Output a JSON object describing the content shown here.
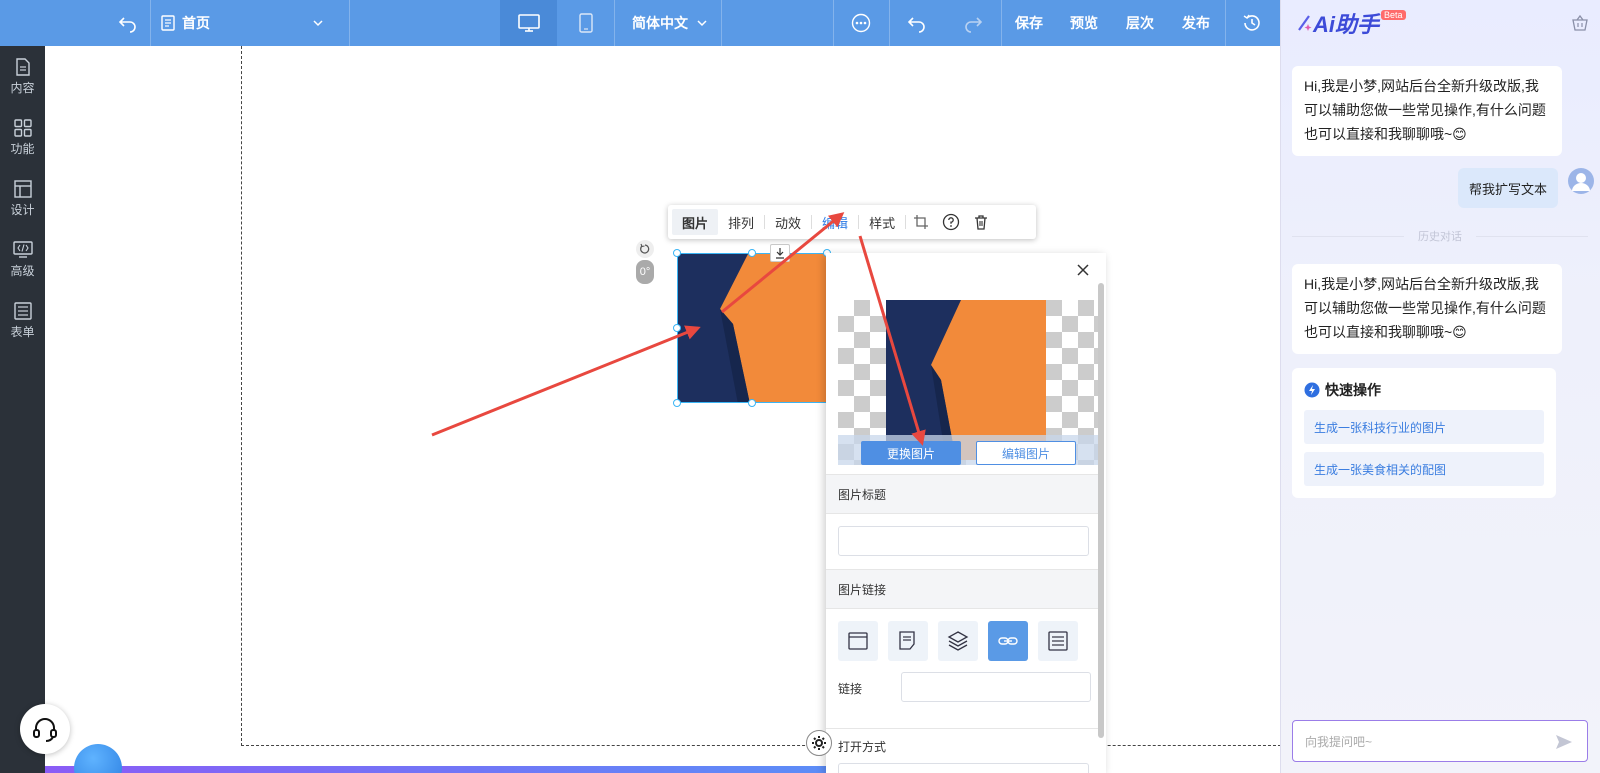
{
  "topbar": {
    "page_select": "首页",
    "language": "简体中文",
    "save": "保存",
    "preview": "预览",
    "layers": "层次",
    "publish": "发布"
  },
  "sidebar": {
    "items": [
      {
        "label": "内容",
        "icon": "document-icon"
      },
      {
        "label": "功能",
        "icon": "grid-icon"
      },
      {
        "label": "设计",
        "icon": "layout-icon"
      },
      {
        "label": "高级",
        "icon": "code-icon"
      },
      {
        "label": "表单",
        "icon": "form-icon"
      }
    ]
  },
  "image_toolbar": {
    "tabs": [
      "图片",
      "排列",
      "动效",
      "编辑",
      "样式"
    ]
  },
  "selected_image": {
    "rotation": "0°"
  },
  "edit_panel": {
    "replace_button": "更换图片",
    "edit_button": "编辑图片",
    "title_section": "图片标题",
    "title_value": "",
    "link_section": "图片链接",
    "link_label": "链接",
    "link_value": "",
    "open_mode_section": "打开方式",
    "link_types": [
      "page-link-icon",
      "article-link-icon",
      "layer-link-icon",
      "url-link-icon",
      "list-link-icon"
    ],
    "active_link_type": 3
  },
  "ai_panel": {
    "logo": "Ai助手",
    "beta": "Beta",
    "greeting_1": "Hi,我是小梦,网站后台全新升级改版,我可以辅助您做一些常见操作,有什么问题也可以直接和我聊聊哦~😊",
    "user_message": "帮我扩写文本",
    "history_label": "历史对话",
    "greeting_2": "Hi,我是小梦,网站后台全新升级改版,我可以辅助您做一些常见操作,有什么问题也可以直接和我聊聊哦~😊",
    "quick_title": "快速操作",
    "quick_items": [
      "生成一张科技行业的图片",
      "生成一张美食相关的配图"
    ],
    "input_placeholder": "向我提问吧~"
  },
  "colors": {
    "topbar": "#5a9ae6",
    "sidebar": "#2b3139",
    "accent": "#4f8fe3",
    "arrow": "#e8483f",
    "image_dark": "#1d2f5e",
    "image_orange": "#f28a3a"
  }
}
